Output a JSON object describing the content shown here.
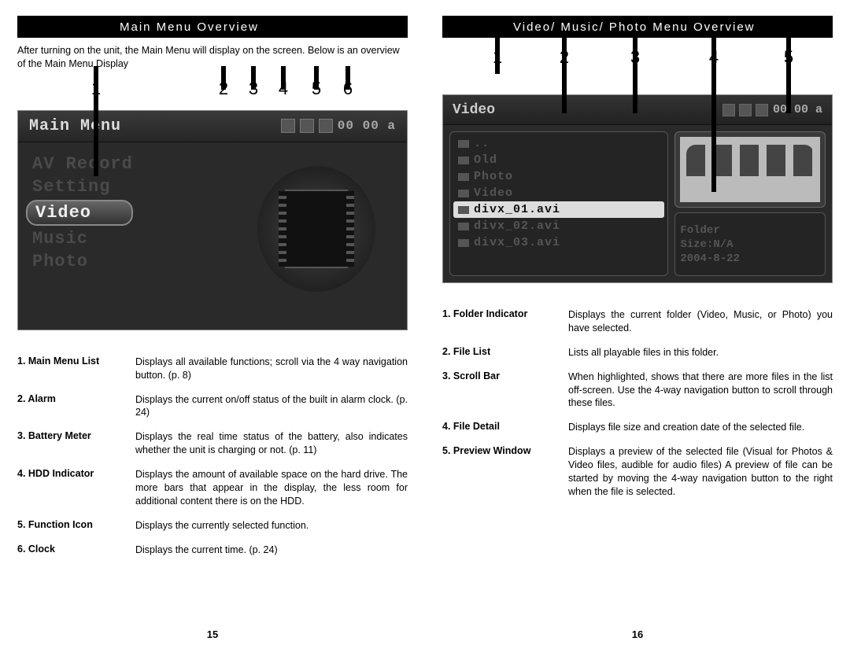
{
  "left": {
    "title": "Main Menu Overview",
    "intro": "After turning on the unit, the Main Menu will display on the screen. Below is an overview of the Main Menu Display",
    "callouts": [
      "1",
      "2",
      "3",
      "4",
      "5",
      "6"
    ],
    "screenshot": {
      "header_title": "Main Menu",
      "clock": "00 00 a",
      "menu_items": [
        "AV Record",
        "Setting",
        "Video",
        "Music",
        "Photo"
      ],
      "selected_index": 2
    },
    "legend": [
      {
        "term": "1. Main Menu List",
        "desc": "Displays all available functions; scroll via the 4 way navigation button. (p. 8)"
      },
      {
        "term": "2. Alarm",
        "desc": "Displays the current on/off status of the built in alarm clock. (p. 24)"
      },
      {
        "term": "3. Battery Meter",
        "desc": "Displays the real time status of the battery, also indicates whether the unit is charging or not. (p. 11)"
      },
      {
        "term": "4. HDD Indicator",
        "desc": "Displays the amount of available space on the hard drive. The more bars that appear in the display, the less room for additional content there is on the HDD."
      },
      {
        "term": "5. Function Icon",
        "desc": "Displays the currently selected function."
      },
      {
        "term": "6. Clock",
        "desc": "Displays the current time. (p. 24)"
      }
    ],
    "page_num": "15"
  },
  "right": {
    "title": "Video/ Music/ Photo Menu Overview",
    "callouts": [
      "1",
      "2",
      "3",
      "4",
      "5"
    ],
    "screenshot": {
      "header_title": "Video",
      "clock": "00 00 a",
      "list": [
        "..",
        "Old",
        "Photo",
        "Video",
        "divx_01.avi",
        "divx_02.avi",
        "divx_03.avi"
      ],
      "selected_index": 4,
      "detail": [
        "Folder",
        "Size:N/A",
        "2004-8-22"
      ]
    },
    "legend": [
      {
        "term": "1. Folder Indicator",
        "desc": "Displays the current folder (Video, Music, or Photo) you have selected."
      },
      {
        "term": "2. File List",
        "desc": "Lists all playable files in this folder."
      },
      {
        "term": "3. Scroll Bar",
        "desc": "When highlighted, shows that there are more files in the list off-screen. Use the 4-way navigation button to scroll through these files."
      },
      {
        "term": "4. File Detail",
        "desc": "Displays file size and creation date of the selected file."
      },
      {
        "term": "5. Preview Window",
        "desc": "Displays a preview of the selected file (Visual for Photos & Video files, audible for audio files) A preview of file can be started by moving the 4-way navigation button to the right when the file is selected."
      }
    ],
    "page_num": "16"
  }
}
